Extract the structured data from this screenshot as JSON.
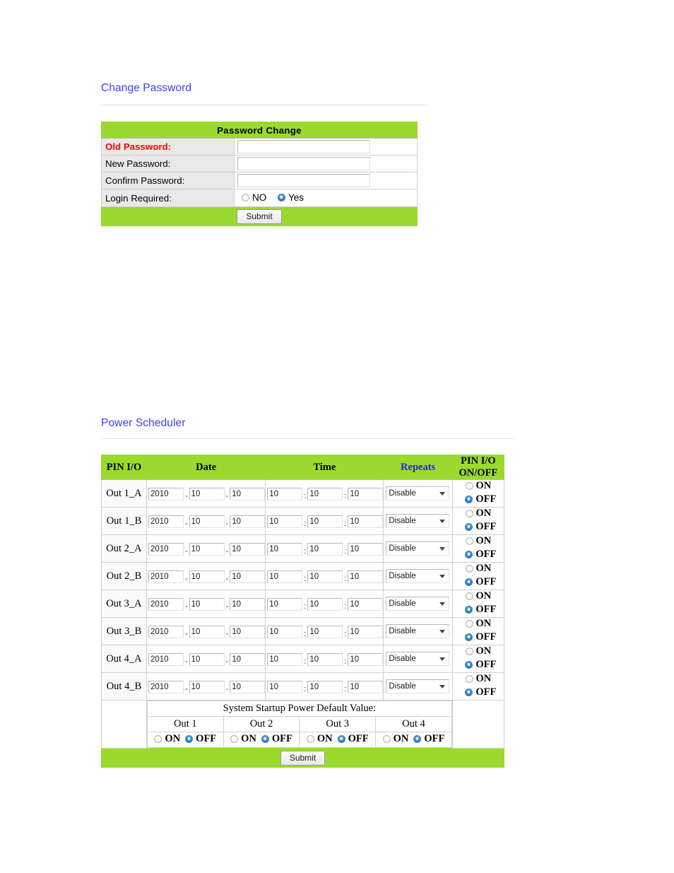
{
  "sections": {
    "password": {
      "heading": "Change Password",
      "table_title": "Password Change",
      "rows": [
        {
          "label": "Old Password:",
          "value": "",
          "required": true
        },
        {
          "label": "New Password:",
          "value": "",
          "required": false
        },
        {
          "label": "Confirm Password:",
          "value": "",
          "required": false
        }
      ],
      "login_required": {
        "label": "Login Required:",
        "options": [
          {
            "label": "NO",
            "checked": false
          },
          {
            "label": "Yes",
            "checked": true
          }
        ]
      },
      "submit_label": "Submit"
    },
    "scheduler": {
      "heading": "Power Scheduler",
      "headers": {
        "pin": "PIN I/O",
        "date": "Date",
        "time": "Time",
        "repeats": "Repeats",
        "onoff": "PIN I/O ON/OFF"
      },
      "header_colors": {
        "default": "#000000",
        "repeats": "#2020f0"
      },
      "date_separator": "-",
      "time_separator": ":",
      "onoff_options": {
        "on": "ON",
        "off": "OFF"
      },
      "repeat_value": "Disable",
      "rows": [
        {
          "pin": "Out 1_A",
          "year": "2010",
          "month": "10",
          "day": "10",
          "hour": "10",
          "minute": "10",
          "second": "10",
          "repeats": "Disable",
          "state": "OFF"
        },
        {
          "pin": "Out 1_B",
          "year": "2010",
          "month": "10",
          "day": "10",
          "hour": "10",
          "minute": "10",
          "second": "10",
          "repeats": "Disable",
          "state": "OFF"
        },
        {
          "pin": "Out 2_A",
          "year": "2010",
          "month": "10",
          "day": "10",
          "hour": "10",
          "minute": "10",
          "second": "10",
          "repeats": "Disable",
          "state": "OFF"
        },
        {
          "pin": "Out 2_B",
          "year": "2010",
          "month": "10",
          "day": "10",
          "hour": "10",
          "minute": "10",
          "second": "10",
          "repeats": "Disable",
          "state": "OFF"
        },
        {
          "pin": "Out 3_A",
          "year": "2010",
          "month": "10",
          "day": "10",
          "hour": "10",
          "minute": "10",
          "second": "10",
          "repeats": "Disable",
          "state": "OFF"
        },
        {
          "pin": "Out 3_B",
          "year": "2010",
          "month": "10",
          "day": "10",
          "hour": "10",
          "minute": "10",
          "second": "10",
          "repeats": "Disable",
          "state": "OFF"
        },
        {
          "pin": "Out 4_A",
          "year": "2010",
          "month": "10",
          "day": "10",
          "hour": "10",
          "minute": "10",
          "second": "10",
          "repeats": "Disable",
          "state": "OFF"
        },
        {
          "pin": "Out 4_B",
          "year": "2010",
          "month": "10",
          "day": "10",
          "hour": "10",
          "minute": "10",
          "second": "10",
          "repeats": "Disable",
          "state": "OFF"
        }
      ],
      "startup": {
        "title": "System Startup Power Default Value:",
        "outputs": [
          {
            "label": "Out 1",
            "state": "OFF"
          },
          {
            "label": "Out 2",
            "state": "OFF"
          },
          {
            "label": "Out 3",
            "state": "OFF"
          },
          {
            "label": "Out 4",
            "state": "OFF"
          }
        ]
      },
      "submit_label": "Submit"
    }
  },
  "colors": {
    "accent_green": "#9ada2e",
    "heading_blue": "#4040f2",
    "required_red": "#ff0000",
    "label_gray": "#e9e9e9"
  }
}
